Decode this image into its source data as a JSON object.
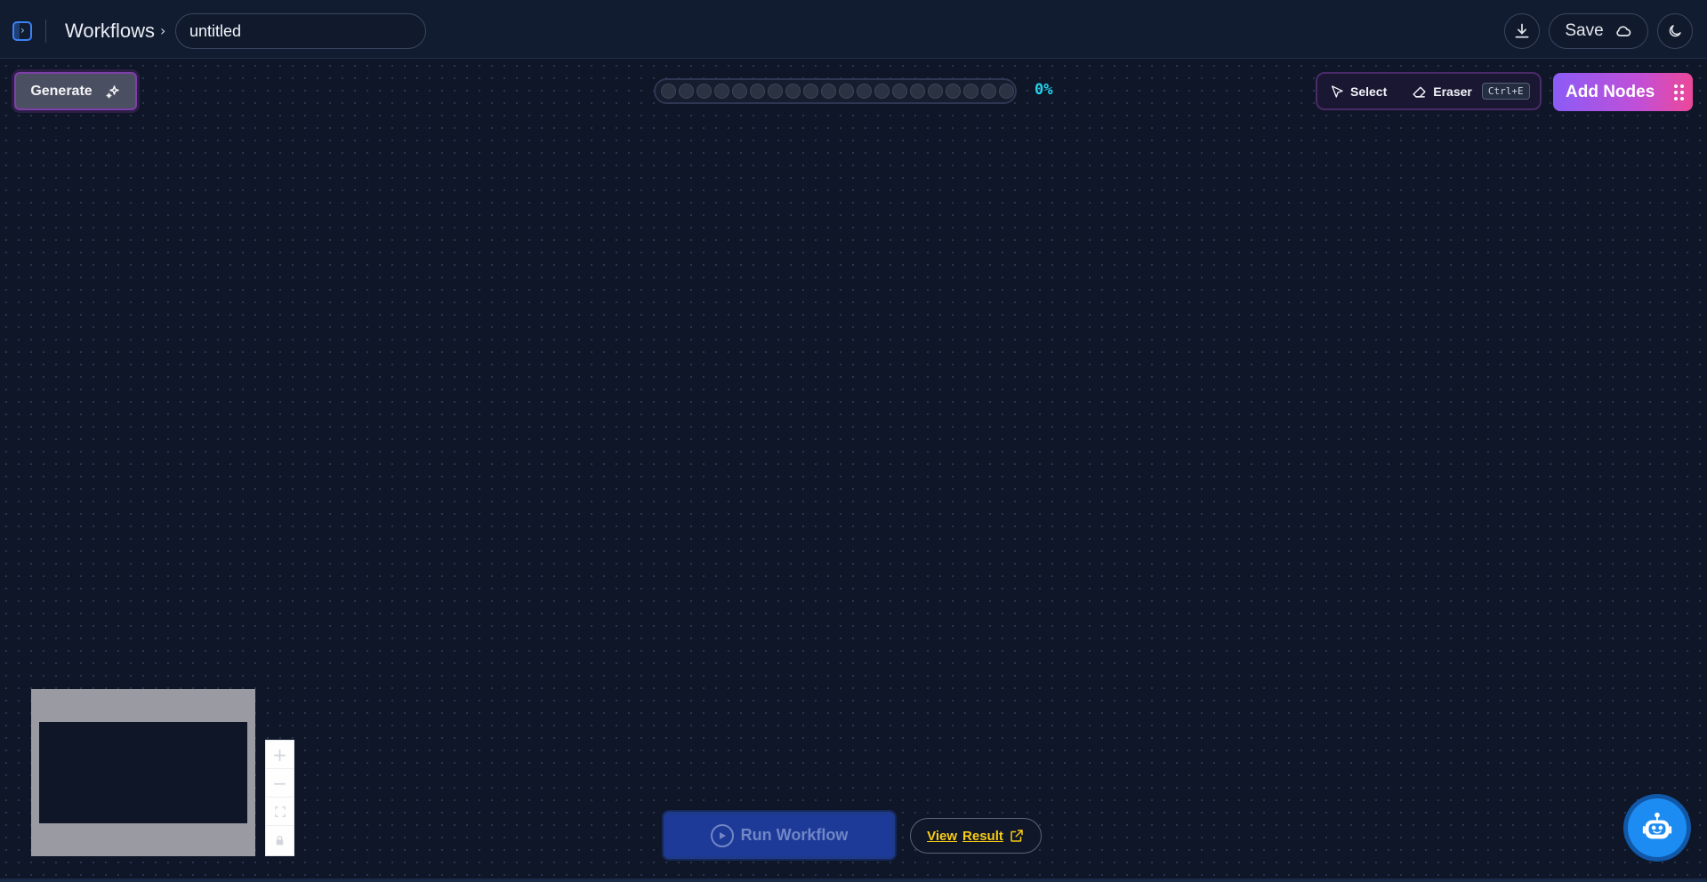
{
  "header": {
    "breadcrumb": "Workflows",
    "workflow_title": "untitled",
    "save_label": "Save"
  },
  "toolbar": {
    "generate_label": "Generate",
    "progress_percent_label": "0%",
    "progress_value": 0,
    "progress_dot_count": 20,
    "select_label": "Select",
    "eraser_label": "Eraser",
    "eraser_shortcut": "Ctrl+E",
    "add_nodes_label": "Add Nodes"
  },
  "bottom": {
    "run_label": "Run Workflow",
    "view_label": "View",
    "result_label": "Result"
  },
  "icons": {
    "sidebar": "sidebar-toggle-icon",
    "download": "download-icon",
    "save": "cloud-icon",
    "theme": "moon-icon",
    "generate": "sparkles-icon",
    "select": "cursor-icon",
    "eraser": "eraser-icon",
    "add_nodes": "grip-icon",
    "run": "play-icon",
    "view_result": "external-link-icon",
    "assistant": "robot-icon"
  },
  "colors": {
    "accent_blue": "#3b82f6",
    "accent_purple": "#8b5cf6",
    "accent_pink": "#ec4899",
    "progress_text": "#22d3ee",
    "view_result_text": "#facc15"
  }
}
